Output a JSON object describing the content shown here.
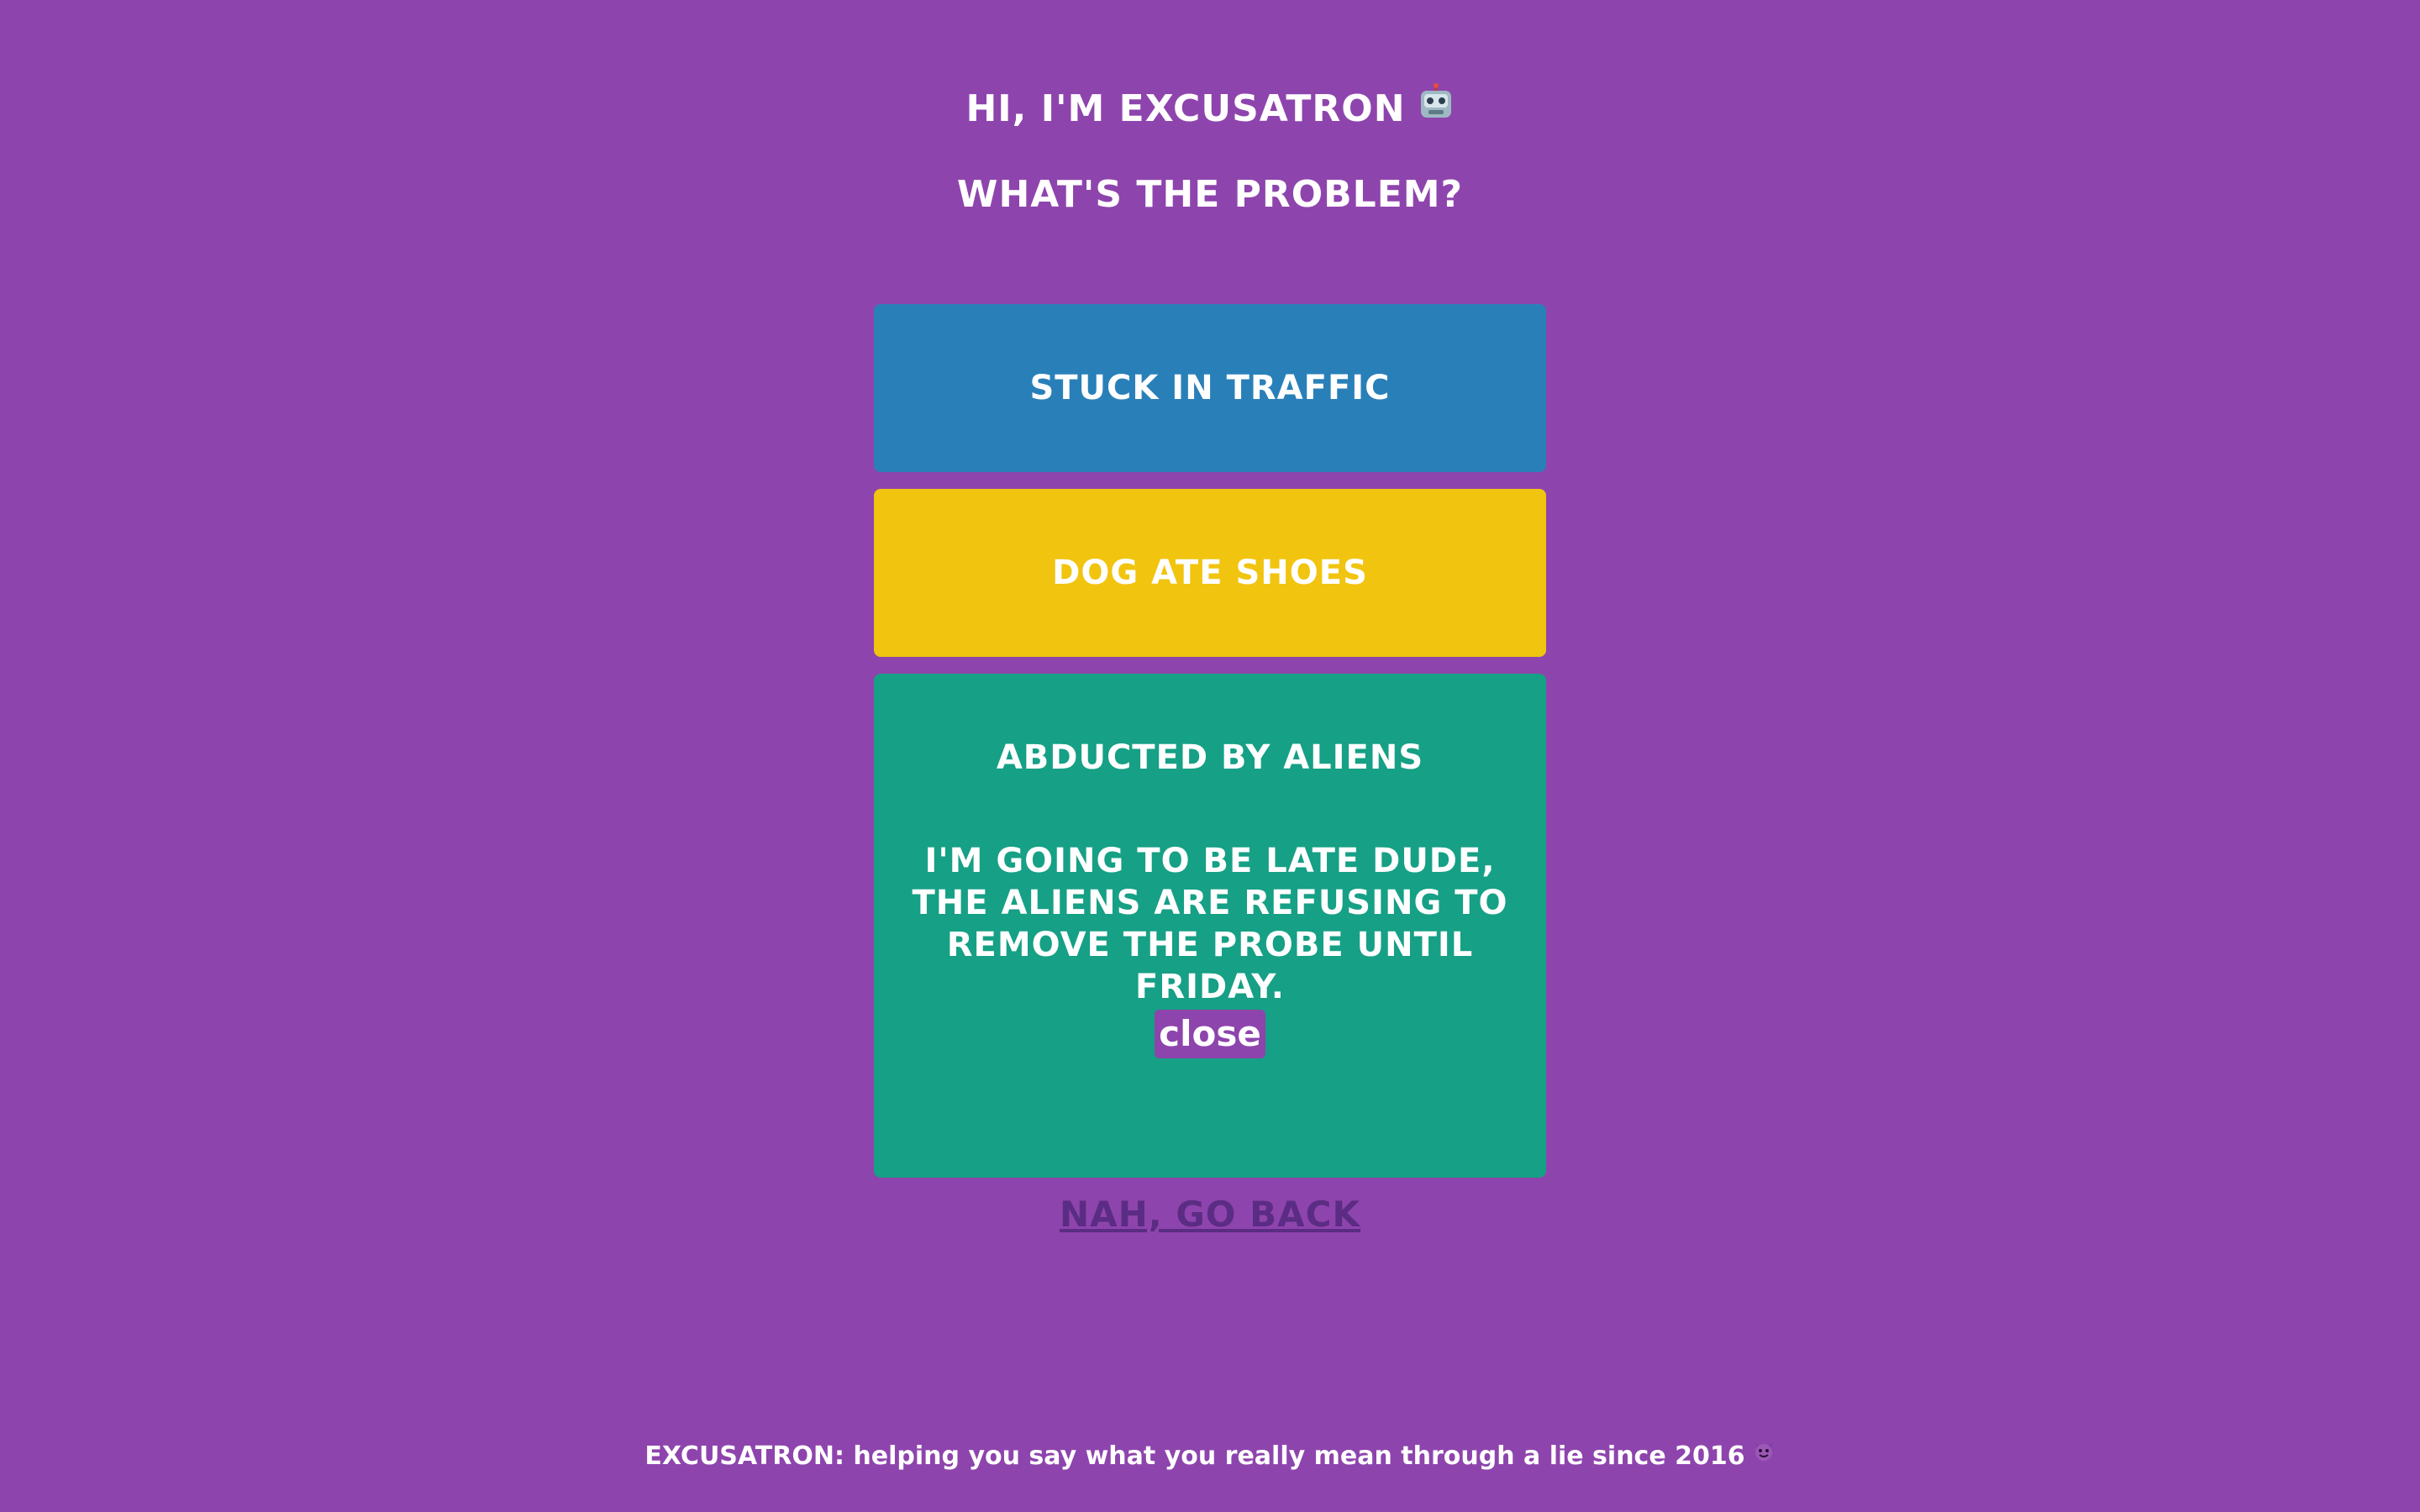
{
  "header": {
    "greeting": "HI, I'M EXCUSATRON",
    "greeting_icon": "robot-icon",
    "question": "WHAT'S THE PROBLEM?"
  },
  "options": [
    {
      "label": "STUCK IN TRAFFIC",
      "color": "#2980b9"
    },
    {
      "label": "DOG ATE SHOES",
      "color": "#f1c40f"
    },
    {
      "label": "ABDUCTED BY ALIENS",
      "color": "#16a085"
    }
  ],
  "excuse": {
    "text": "I'M GOING TO BE LATE DUDE, THE ALIENS ARE REFUSING TO REMOVE THE PROBE UNTIL FRIDAY.",
    "close_label": "close"
  },
  "back_link": "NAH, GO BACK",
  "footer": {
    "brand": "EXCUSATRON:",
    "tagline": " helping you say what you really mean through a lie since 2016",
    "icon": "devil-icon"
  },
  "colors": {
    "background": "#8e44ad",
    "link": "#5b2c83"
  }
}
